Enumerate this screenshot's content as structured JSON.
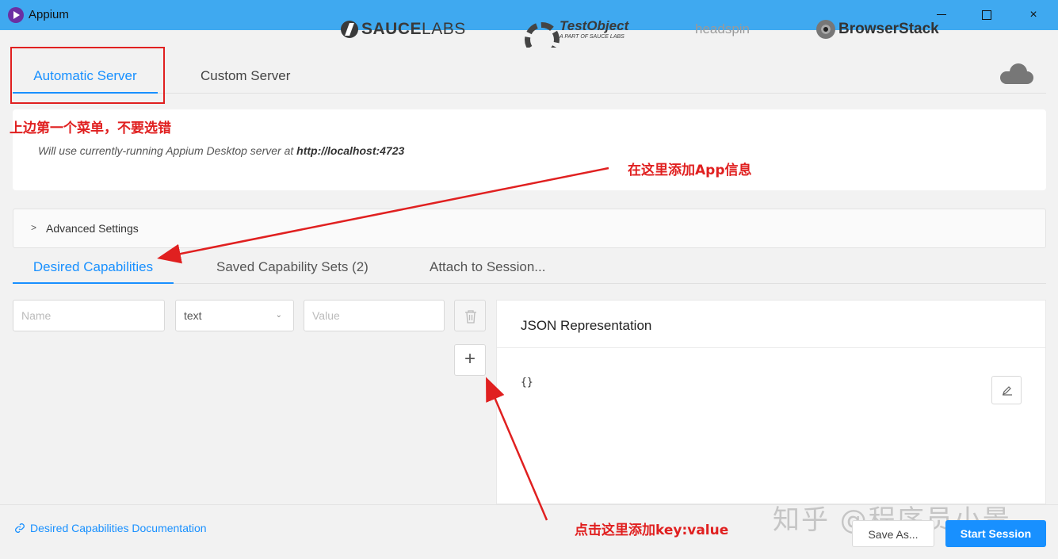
{
  "window": {
    "title": "Appium",
    "minimize": "minimize",
    "maximize": "maximize",
    "close": "×"
  },
  "server_tabs": {
    "automatic": "Automatic Server",
    "custom": "Custom Server",
    "saucelabs_bold": "SAUCE",
    "saucelabs_light": "LABS",
    "testobject": "TestObject",
    "testobject_sub": "A PART OF SAUCE LABS",
    "headspin": "headspin",
    "browserstack": "BrowserStack"
  },
  "info": {
    "text": "Will use currently-running Appium Desktop server at ",
    "url": "http://localhost:4723"
  },
  "advanced": {
    "label": "Advanced Settings",
    "chevron": ">"
  },
  "cap_tabs": {
    "desired": "Desired Capabilities",
    "saved": "Saved Capability Sets (2)",
    "attach": "Attach to Session..."
  },
  "capability_row": {
    "name_placeholder": "Name",
    "type_value": "text",
    "value_placeholder": "Value",
    "add_label": "+"
  },
  "json_panel": {
    "title": "JSON Representation",
    "content": "{}"
  },
  "footer": {
    "doc_link": "Desired Capabilities Documentation",
    "save_as": "Save As...",
    "start_session": "Start Session"
  },
  "annotations": {
    "top_menu_note": "上边第一个菜单，不要选错",
    "add_app_note": "在这里添加App信息",
    "add_keyvalue_note": "点击这里添加key:value"
  },
  "watermark": "知乎 @程序员小景",
  "colors": {
    "titlebar": "#3fa9f0",
    "accent": "#1890ff",
    "annotation": "#e02020"
  }
}
